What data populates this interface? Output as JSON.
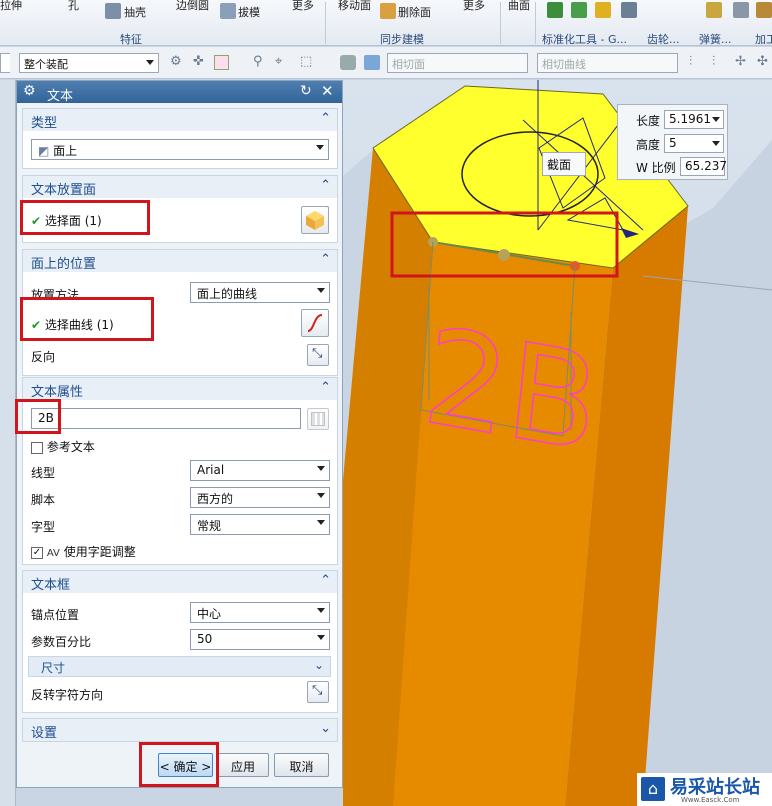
{
  "ribbon": {
    "items": [
      "拉伸",
      "孔",
      "抽壳",
      "边倒圆",
      "拔模",
      "更多",
      "移动面",
      "删除面",
      "更多",
      "曲面"
    ],
    "groups": [
      "特征",
      "同步建模",
      "标准化工具 - G...",
      "齿轮...",
      "弹簧...",
      "加工"
    ]
  },
  "toolbar": {
    "assembly_filter": "整个装配",
    "face_rule": "相切面",
    "curve_rule": "相切曲线"
  },
  "dialog": {
    "title": "文本",
    "type_section": {
      "header": "类型",
      "value": "面上"
    },
    "placement_face": {
      "header": "文本放置面",
      "select_label": "选择面 (1)"
    },
    "position": {
      "header": "面上的位置",
      "method_label": "放置方法",
      "method_value": "面上的曲线",
      "select_label": "选择曲线 (1)",
      "reverse_label": "反向"
    },
    "props": {
      "header": "文本属性",
      "text_value": "2B",
      "ref_text_label": "参考文本",
      "line_type_label": "线型",
      "line_type_value": "Arial",
      "script_label": "脚本",
      "script_value": "西方的",
      "style_label": "字型",
      "style_value": "常规",
      "kerning_label": "使用字距调整"
    },
    "frame": {
      "header": "文本框",
      "anchor_label": "锚点位置",
      "anchor_value": "中心",
      "percent_label": "参数百分比",
      "percent_value": "50",
      "size_label": "尺寸",
      "reverse_dir_label": "反转字符方向"
    },
    "settings": {
      "header": "设置"
    },
    "buttons": {
      "ok": "< 确定 >",
      "apply": "应用",
      "cancel": "取消"
    }
  },
  "viewport": {
    "text_preview": "2B",
    "section_label": "截面",
    "dims": {
      "length_label": "长度",
      "length_value": "5.1961",
      "height_label": "高度",
      "height_value": "5",
      "wscale_label": "W 比例",
      "wscale_value": "65.237"
    }
  },
  "watermark": {
    "text": "易采站长站",
    "sub": "Www.Easck.Com"
  },
  "colors": {
    "prism_side": "#e48a00",
    "prism_top": "#ffff33",
    "highlight": "#d0161c",
    "title_bar": "#3f6fa4"
  }
}
